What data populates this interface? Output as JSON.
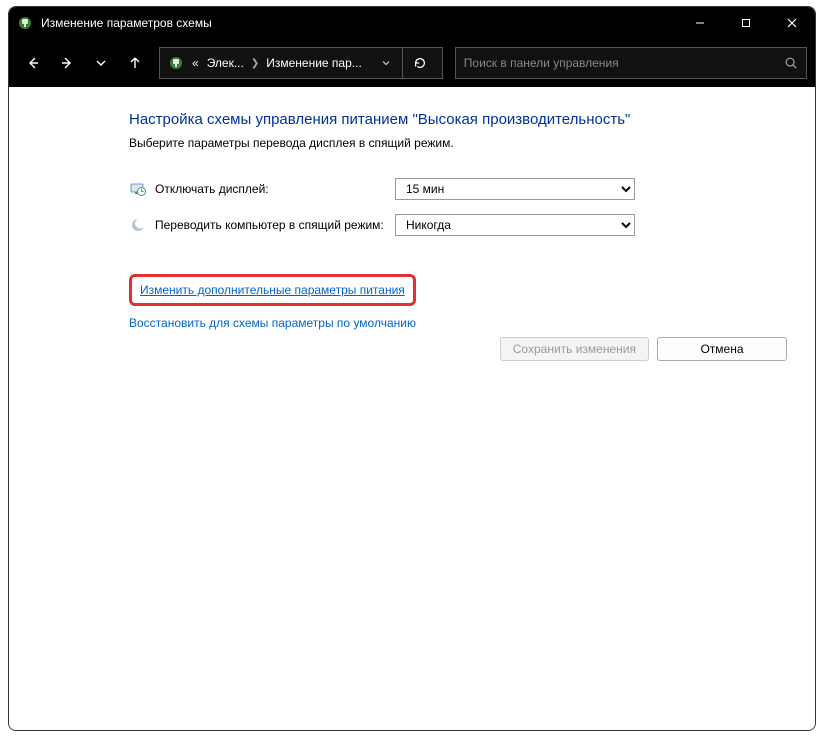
{
  "window": {
    "title": "Изменение параметров схемы"
  },
  "breadcrumb": {
    "seg1_prefix": "«",
    "seg1": "Элек...",
    "seg2": "Изменение пар..."
  },
  "search": {
    "placeholder": "Поиск в панели управления"
  },
  "page": {
    "title": "Настройка схемы управления питанием \"Высокая производительность\"",
    "subtitle": "Выберите параметры перевода дисплея в спящий режим."
  },
  "settings": {
    "display_off_label": "Отключать дисплей:",
    "display_off_value": "15 мин",
    "sleep_label": "Переводить компьютер в спящий режим:",
    "sleep_value": "Никогда"
  },
  "links": {
    "advanced": "Изменить дополнительные параметры питания",
    "restore": "Восстановить для схемы параметры по умолчанию"
  },
  "buttons": {
    "save": "Сохранить изменения",
    "cancel": "Отмена"
  }
}
